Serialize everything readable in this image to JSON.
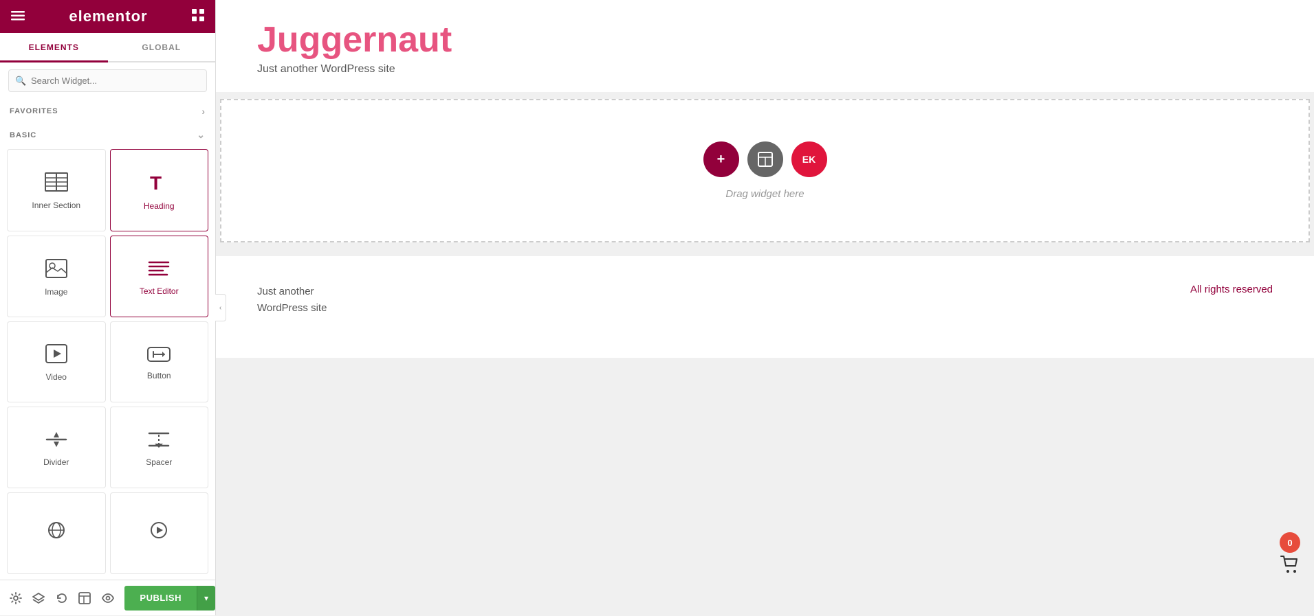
{
  "sidebar": {
    "header": {
      "logo": "elementor",
      "menu_label": "menu",
      "grid_label": "grid"
    },
    "tabs": [
      {
        "id": "elements",
        "label": "ELEMENTS",
        "active": true
      },
      {
        "id": "global",
        "label": "GLOBAL",
        "active": false
      }
    ],
    "search": {
      "placeholder": "Search Widget..."
    },
    "sections": [
      {
        "id": "favorites",
        "label": "FAVORITES",
        "collapsed": true,
        "items": []
      },
      {
        "id": "basic",
        "label": "BASIC",
        "collapsed": false,
        "items": [
          {
            "id": "inner-section",
            "label": "Inner Section",
            "icon": "inner-section-icon"
          },
          {
            "id": "heading",
            "label": "Heading",
            "icon": "heading-icon"
          },
          {
            "id": "image",
            "label": "Image",
            "icon": "image-icon"
          },
          {
            "id": "text-editor",
            "label": "Text Editor",
            "icon": "text-editor-icon"
          },
          {
            "id": "video",
            "label": "Video",
            "icon": "video-icon"
          },
          {
            "id": "button",
            "label": "Button",
            "icon": "button-icon"
          },
          {
            "id": "divider",
            "label": "Divider",
            "icon": "divider-icon"
          },
          {
            "id": "spacer",
            "label": "Spacer",
            "icon": "spacer-icon"
          },
          {
            "id": "widget9",
            "label": "",
            "icon": "widget9-icon"
          },
          {
            "id": "widget10",
            "label": "",
            "icon": "widget10-icon"
          }
        ]
      }
    ],
    "footer": {
      "publish_label": "PUBLISH",
      "publish_arrow": "▾"
    }
  },
  "canvas": {
    "site_title": "Juggernaut",
    "site_tagline": "Just another WordPress site",
    "drop_zone": {
      "text": "Drag widget here",
      "btn_add": "+",
      "btn_section": "▣",
      "btn_ek": "EK"
    },
    "footer_left_line1": "Just another",
    "footer_left_line2": "WordPress site",
    "footer_right": "All rights reserved",
    "cart_count": "0"
  },
  "colors": {
    "primary": "#92003b",
    "pink_title": "#e75480",
    "green_publish": "#4caf50",
    "red_cart": "#e74c3c"
  }
}
